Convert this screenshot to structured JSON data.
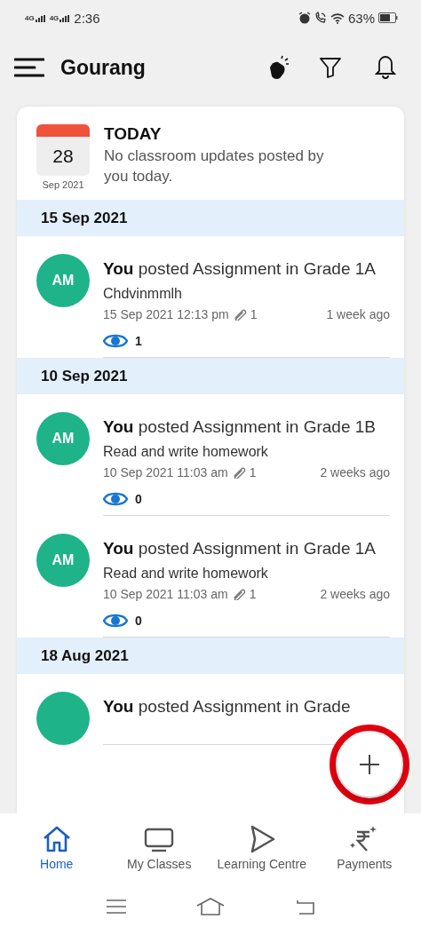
{
  "status_bar": {
    "network_1": "4G",
    "network_2": "4G",
    "time": "2:36",
    "battery": "63%"
  },
  "header": {
    "title": "Gourang"
  },
  "today": {
    "day": "28",
    "month": "Sep 2021",
    "title": "TODAY",
    "message": "No classroom updates posted by you today."
  },
  "feed": [
    {
      "date": "15 Sep 2021",
      "posts": [
        {
          "avatar": "AM",
          "headline": "**You**  posted Assignment in Grade 1A",
          "description": "Chdvinmmlh",
          "timestamp": "15 Sep 2021 12:13 pm",
          "attachments": "1",
          "age": "1 week ago",
          "views": "1"
        }
      ]
    },
    {
      "date": "10 Sep 2021",
      "posts": [
        {
          "avatar": "AM",
          "headline": "**You**  posted Assignment in Grade 1B",
          "description": "Read and write homework",
          "timestamp": "10 Sep 2021 11:03 am",
          "attachments": "1",
          "age": "2 weeks ago",
          "views": "0"
        },
        {
          "avatar": "AM",
          "headline": "**You**  posted Assignment in Grade 1A",
          "description": "Read and write homework",
          "timestamp": "10 Sep 2021 11:03 am",
          "attachments": "1",
          "age": "2 weeks ago",
          "views": "0"
        }
      ]
    },
    {
      "date": "18 Aug 2021",
      "posts": [
        {
          "headline": "**You**  posted Assignment in Grade"
        }
      ]
    }
  ],
  "fab": {
    "highlighted": true
  },
  "bottom_nav": [
    {
      "kind": "home",
      "label": "Home",
      "selected": true
    },
    {
      "kind": "classes",
      "label": "My Classes",
      "selected": false
    },
    {
      "kind": "learning",
      "label": "Learning Centre",
      "selected": false
    },
    {
      "kind": "payments",
      "label": "Payments",
      "selected": false
    }
  ]
}
